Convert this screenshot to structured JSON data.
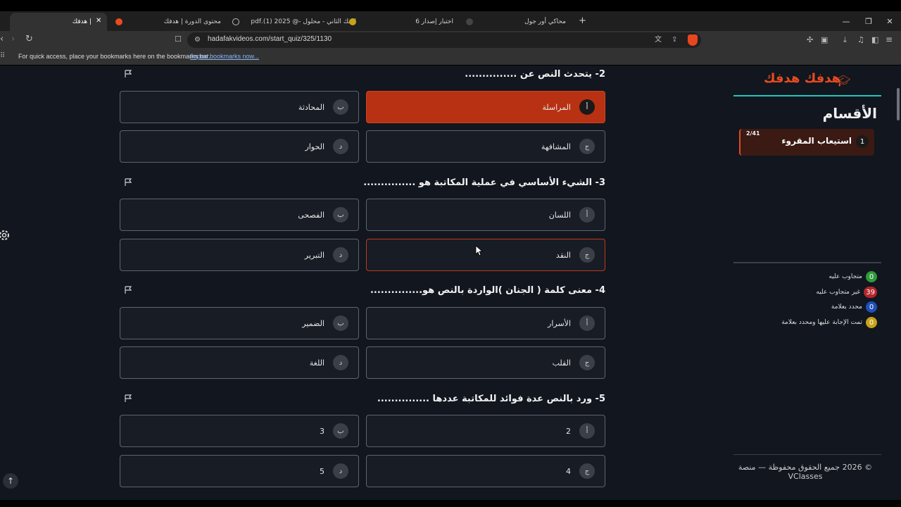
{
  "browser": {
    "tabs": [
      {
        "title": "| هدفك",
        "active": true
      },
      {
        "title": "محتوى الدورة | هدفك"
      },
      {
        "title": "البنك الثاني - محلول -@ 2025 (1).pdf"
      },
      {
        "title": "اختبار إصدار 6"
      },
      {
        "title": "محاكي أور جول"
      }
    ],
    "url": "hadafakvideos.com/start_quiz/325/1130",
    "bookmarks_hint": "For quick access, place your bookmarks here on the bookmarks bar.",
    "bookmarks_link": "Import bookmarks now..."
  },
  "quiz": {
    "questions": [
      {
        "title": "2- يتحدث النص عن ...............",
        "options": [
          {
            "letter": "أ",
            "text": "المراسلة",
            "state": "selected"
          },
          {
            "letter": "ب",
            "text": "المحادثة",
            "state": "normal"
          },
          {
            "letter": "ج",
            "text": "المشافهة",
            "state": "normal"
          },
          {
            "letter": "د",
            "text": "الحوار",
            "state": "normal"
          }
        ]
      },
      {
        "title": "3- الشيء الأساسي في عملية المكاتبة هو ...............",
        "options": [
          {
            "letter": "أ",
            "text": "اللسان",
            "state": "normal"
          },
          {
            "letter": "ب",
            "text": "الفصحى",
            "state": "normal"
          },
          {
            "letter": "ج",
            "text": "النقد",
            "state": "hover"
          },
          {
            "letter": "د",
            "text": "التبرير",
            "state": "normal"
          }
        ]
      },
      {
        "title": "4- معنى كلمة ( الجنان )الواردة بالنص هو...............",
        "options": [
          {
            "letter": "أ",
            "text": "الأسرار",
            "state": "normal"
          },
          {
            "letter": "ب",
            "text": "الضمير",
            "state": "normal"
          },
          {
            "letter": "ج",
            "text": "القلب",
            "state": "normal"
          },
          {
            "letter": "د",
            "text": "اللغة",
            "state": "normal"
          }
        ]
      },
      {
        "title": "5- ورد بالنص عدة فوائد للمكاتبة عددها ...............",
        "options": [
          {
            "letter": "أ",
            "text": "2",
            "state": "normal"
          },
          {
            "letter": "ب",
            "text": "3",
            "state": "normal"
          },
          {
            "letter": "ج",
            "text": "4",
            "state": "normal"
          },
          {
            "letter": "د",
            "text": "5",
            "state": "normal"
          }
        ]
      }
    ]
  },
  "sidebar": {
    "brand": "هدفك هدفك",
    "sections_title": "الأقسام",
    "section": {
      "number": "1",
      "name": "استيعاب المقروء",
      "progress": "2/41"
    },
    "stats": [
      {
        "count": "0",
        "label": "متجاوب عليه",
        "color": "#2e9b3a"
      },
      {
        "count": "39",
        "label": "غير متجاوب عليه",
        "color": "#b3262c"
      },
      {
        "count": "0",
        "label": "محدد بعلامة",
        "color": "#1f4fb8"
      },
      {
        "count": "0",
        "label": "تمت الإجابة عليها ومحدد بعلامة",
        "color": "#c9a317"
      }
    ],
    "footer": "© 2026 جميع الحقوق محفوظة — منصة VClasses"
  }
}
